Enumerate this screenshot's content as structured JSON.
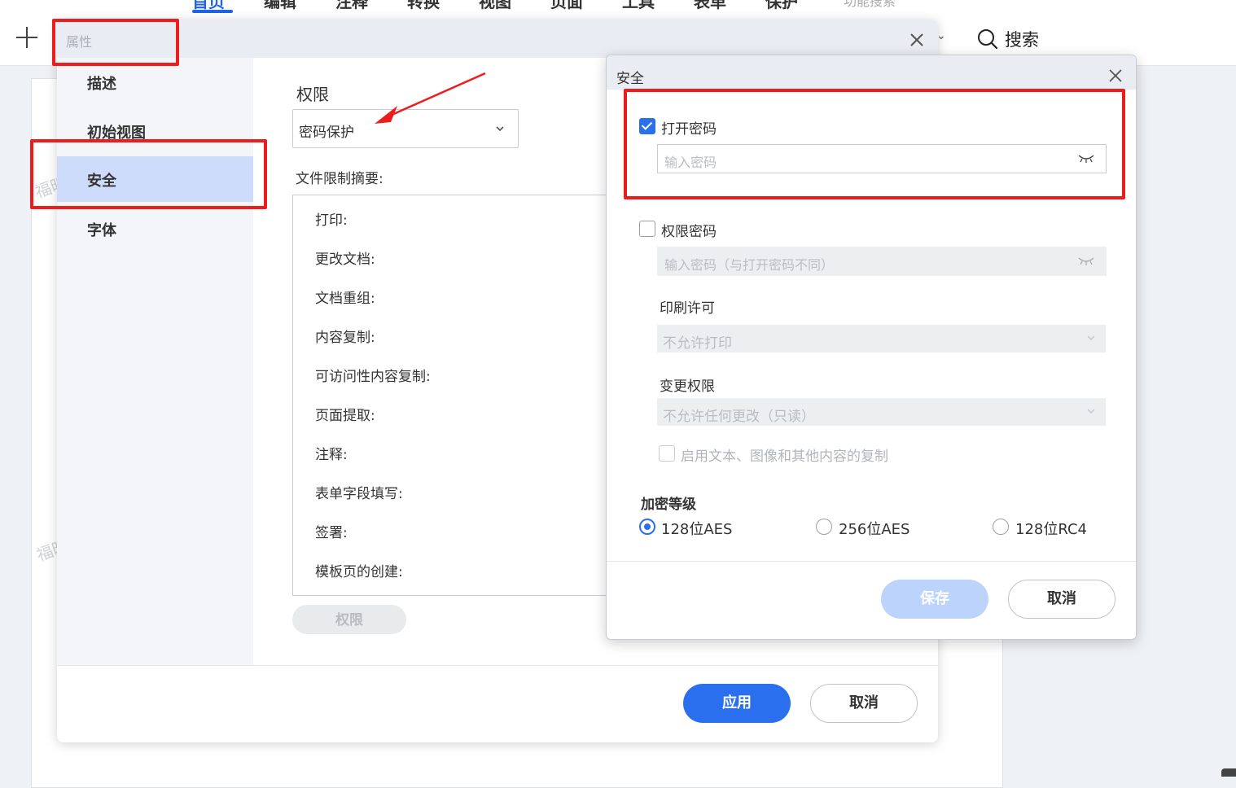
{
  "topbar": {
    "menu": [
      "首页",
      "编辑",
      "注释",
      "转换",
      "视图",
      "页面",
      "工具",
      "表单",
      "保护"
    ],
    "feature_search": "功能搜索",
    "search_label": "搜索"
  },
  "watermark": "福昕",
  "properties_dialog": {
    "title": "属性",
    "sidebar": [
      "描述",
      "初始视图",
      "安全",
      "字体"
    ],
    "selected_sidebar": "安全",
    "permission_label": "权限",
    "permission_select_value": "密码保护",
    "summary_label": "文件限制摘要:",
    "summary_rows": [
      "打印:",
      "更改文档:",
      "文档重组:",
      "内容复制:",
      "可访问性内容复制:",
      "页面提取:",
      "注释:",
      "表单字段填写:",
      "签署:",
      "模板页的创建:"
    ],
    "permission_button": "权限",
    "apply_button": "应用",
    "cancel_button": "取消"
  },
  "security_dialog": {
    "title": "安全",
    "open_password": {
      "label": "打开密码",
      "checked": true,
      "placeholder": "输入密码"
    },
    "permission_password": {
      "label": "权限密码",
      "checked": false,
      "placeholder": "输入密码（与打开密码不同）"
    },
    "print_permission": {
      "label": "印刷许可",
      "value": "不允许打印"
    },
    "change_permission": {
      "label": "变更权限",
      "value": "不允许任何更改（只读）"
    },
    "enable_copy": {
      "label": "启用文本、图像和其他内容的复制",
      "checked": false
    },
    "encryption": {
      "title": "加密等级",
      "options": [
        "128位AES",
        "256位AES",
        "128位RC4"
      ],
      "selected": "128位AES"
    },
    "save_button": "保存",
    "cancel_button": "取消"
  },
  "colors": {
    "accent": "#2a6fed",
    "highlight": "#ee1d1d",
    "selected_item": "#cddcfa"
  }
}
